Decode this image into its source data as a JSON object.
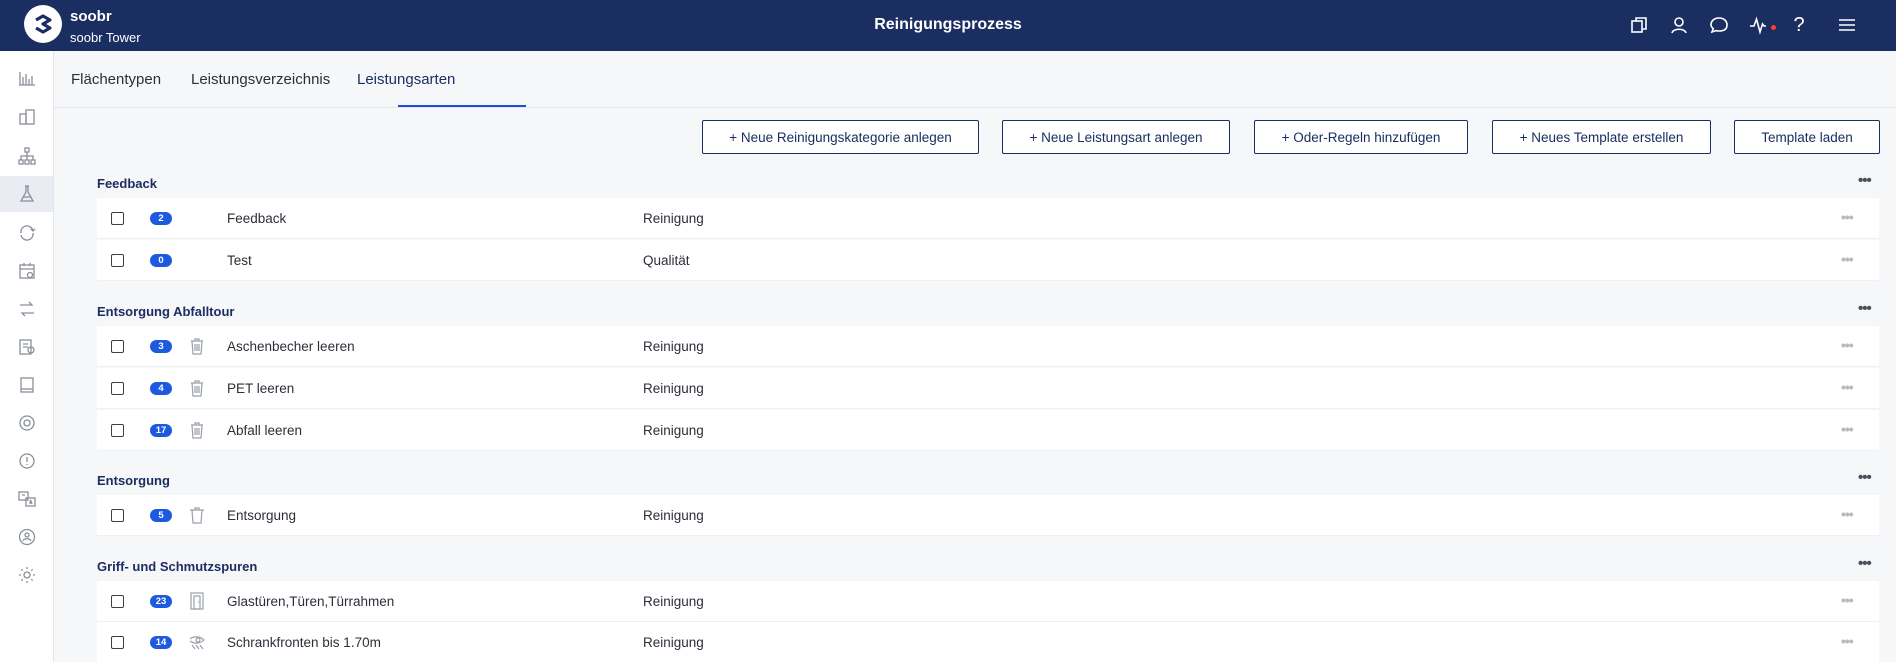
{
  "header": {
    "brand": "soobr",
    "site": "soobr Tower",
    "title": "Reinigungsprozess"
  },
  "tabs": [
    {
      "label": "Flächentypen"
    },
    {
      "label": "Leistungsverzeichnis"
    },
    {
      "label": "Leistungsarten",
      "active": true
    }
  ],
  "toolbar": {
    "new_category": "+ Neue Reinigungskategorie anlegen",
    "new_service_type": "+ Neue Leistungsart anlegen",
    "add_or_rules": "+ Oder-Regeln hinzufügen",
    "new_template": "+ Neues Template erstellen",
    "load_template": "Template laden"
  },
  "groups": [
    {
      "title": "Feedback",
      "rows": [
        {
          "count": "2",
          "name": "Feedback",
          "type": "Reinigung",
          "icon": "none"
        },
        {
          "count": "0",
          "name": "Test",
          "type": "Qualität",
          "icon": "none"
        }
      ]
    },
    {
      "title": "Entsorgung Abfalltour",
      "rows": [
        {
          "count": "3",
          "name": "Aschenbecher leeren",
          "type": "Reinigung",
          "icon": "trash-bin-icon"
        },
        {
          "count": "4",
          "name": "PET leeren",
          "type": "Reinigung",
          "icon": "trash-bin-icon"
        },
        {
          "count": "17",
          "name": "Abfall leeren",
          "type": "Reinigung",
          "icon": "trash-bin-icon"
        }
      ]
    },
    {
      "title": "Entsorgung",
      "rows": [
        {
          "count": "5",
          "name": "Entsorgung",
          "type": "Reinigung",
          "icon": "trash-can-icon"
        }
      ]
    },
    {
      "title": "Griff- und Schmutzspuren",
      "rows": [
        {
          "count": "23",
          "name": "Glastüren,Türen,Türrahmen",
          "type": "Reinigung",
          "icon": "door-icon"
        },
        {
          "count": "14",
          "name": "Schrankfronten bis 1.70m",
          "type": "Reinigung",
          "icon": "cleaning-hand-icon"
        }
      ]
    }
  ],
  "colors": {
    "header_bg": "#1b2e62",
    "accent": "#1d4fd8",
    "badge": "#1d5ae0"
  }
}
